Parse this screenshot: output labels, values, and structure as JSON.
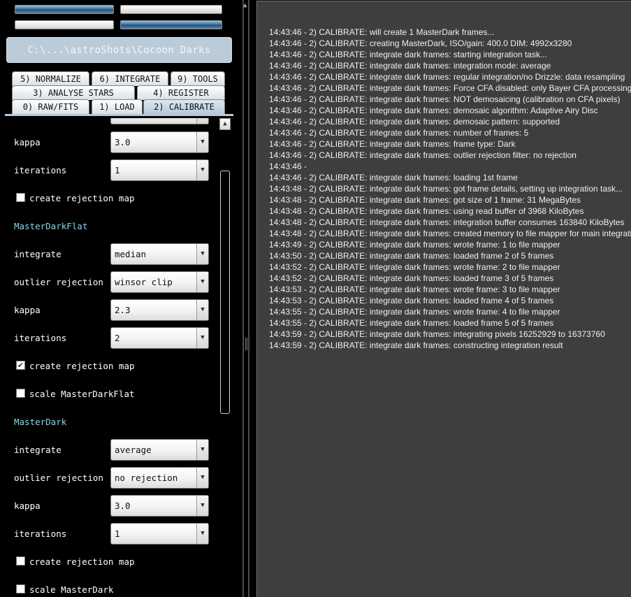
{
  "path": "C:\\...\\astroShots\\Cocoon Darks",
  "tabs": {
    "normalize": "5) NORMALIZE",
    "integrate": "6) INTEGRATE",
    "tools": "9) TOOLS",
    "analyse": "3) ANALYSE STARS",
    "register": "4) REGISTER",
    "raw": "0) RAW/FITS",
    "load": "1) LOAD",
    "calibrate": "2) CALIBRATE"
  },
  "settings": {
    "top": {
      "kappa_label": "kappa",
      "kappa_value": "3.0",
      "iterations_label": "iterations",
      "iterations_value": "1",
      "rejection_map_label": "create rejection map",
      "rejection_map_checked": false
    },
    "masterdarkflat": {
      "title": "MasterDarkFlat",
      "integrate_label": "integrate",
      "integrate_value": "median",
      "outlier_label": "outlier rejection",
      "outlier_value": "winsor clip",
      "kappa_label": "kappa",
      "kappa_value": "2.3",
      "iterations_label": "iterations",
      "iterations_value": "2",
      "rejection_map_label": "create rejection map",
      "rejection_map_checked": true,
      "scale_label": "scale MasterDarkFlat",
      "scale_checked": false
    },
    "masterdark": {
      "title": "MasterDark",
      "integrate_label": "integrate",
      "integrate_value": "average",
      "outlier_label": "outlier rejection",
      "outlier_value": "no rejection",
      "kappa_label": "kappa",
      "kappa_value": "3.0",
      "iterations_label": "iterations",
      "iterations_value": "1",
      "rejection_map_label": "create rejection map",
      "rejection_map_checked": false,
      "scale_label": "scale MasterDark",
      "scale_checked": false
    }
  },
  "checkmark": "✔",
  "log": [
    "14:43:46 - 2) CALIBRATE: will create 1 MasterDark frames...",
    "14:43:46 - 2) CALIBRATE: creating MasterDark, ISO/gain: 400.0 DIM: 4992x3280",
    "14:43:46 - 2) CALIBRATE: integrate dark frames: starting integration task...",
    "14:43:46 - 2) CALIBRATE: integrate dark frames: integration mode: average",
    "14:43:46 - 2) CALIBRATE: integrate dark frames: regular integration/no Drizzle: data resampling",
    "14:43:46 - 2) CALIBRATE: integrate dark frames: Force CFA disabled: only Bayer CFA processing",
    "14:43:46 - 2) CALIBRATE: integrate dark frames: NOT demosaicing (calibration on CFA pixels)",
    "14:43:46 - 2) CALIBRATE: integrate dark frames: demosaic algorithm: Adaptive Airy Disc",
    "14:43:46 - 2) CALIBRATE: integrate dark frames: demosaic pattern: supported",
    "14:43:46 - 2) CALIBRATE: integrate dark frames: number of frames: 5",
    "14:43:46 - 2) CALIBRATE: integrate dark frames: frame type: Dark",
    "14:43:46 - 2) CALIBRATE: integrate dark frames: outlier rejection filter: no rejection",
    "14:43:46 -",
    "14:43:46 - 2) CALIBRATE: integrate dark frames: loading 1st frame",
    "14:43:48 - 2) CALIBRATE: integrate dark frames: got frame details, setting up integration task...",
    "14:43:48 - 2) CALIBRATE: integrate dark frames: got size of 1 frame: 31 MegaBytes",
    "14:43:48 - 2) CALIBRATE: integrate dark frames: using read buffer of 3968 KiloBytes",
    "14:43:48 - 2) CALIBRATE: integrate dark frames: integration buffer consumes 163840 KiloBytes",
    "14:43:48 - 2) CALIBRATE: integrate dark frames: created memory to file mapper for main integration",
    "14:43:49 - 2) CALIBRATE: integrate dark frames: wrote frame: 1 to file mapper",
    "14:43:50 - 2) CALIBRATE: integrate dark frames: loaded frame 2 of 5 frames",
    "14:43:52 - 2) CALIBRATE: integrate dark frames: wrote frame: 2 to file mapper",
    "14:43:52 - 2) CALIBRATE: integrate dark frames: loaded frame 3 of 5 frames",
    "14:43:53 - 2) CALIBRATE: integrate dark frames: wrote frame: 3 to file mapper",
    "14:43:53 - 2) CALIBRATE: integrate dark frames: loaded frame 4 of 5 frames",
    "14:43:55 - 2) CALIBRATE: integrate dark frames: wrote frame: 4 to file mapper",
    "14:43:55 - 2) CALIBRATE: integrate dark frames: loaded frame 5 of 5 frames",
    "14:43:59 - 2) CALIBRATE: integrate dark frames: integrating pixels 16252929 to 16373760",
    "14:43:59 - 2) CALIBRATE: integrate dark frames: constructing integration result"
  ]
}
